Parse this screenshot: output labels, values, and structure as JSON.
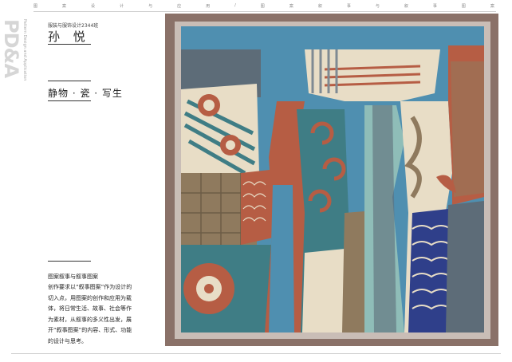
{
  "header": {
    "band": [
      "图",
      "案",
      "设",
      "计",
      "与",
      "应",
      "用",
      "/",
      "图",
      "案",
      "叙",
      "事",
      "与",
      "叙",
      "事",
      "图",
      "案"
    ]
  },
  "side": {
    "logo": "PD&A",
    "subtitle": "Pattern Design and Application"
  },
  "author_block": {
    "course": "服装与服饰设计2344班",
    "name": "孙 悦"
  },
  "work": {
    "title": "静物 · 瓷 · 写生"
  },
  "description": {
    "heading": "图案叙事与叙事图案",
    "body": "创作要求以“叙事图案”作为设计的切入点，用图案的创作和应用为载体，将日常生活、故事、社会等作为素材，从叙事的多义性出发，展开“叙事图案”的内容、形式、功能的设计与思考。"
  },
  "artwork": {
    "colors": {
      "frame": "#8a7168",
      "mat": "#c9bdb6",
      "sky": "#4f8fb0",
      "terracotta": "#b65d44",
      "teal": "#3f7d85",
      "cream": "#e8ddc6",
      "slate": "#5d6c78",
      "olive": "#8f7a5e",
      "navy": "#2f3f8a",
      "mint": "#8fbdb8"
    }
  }
}
